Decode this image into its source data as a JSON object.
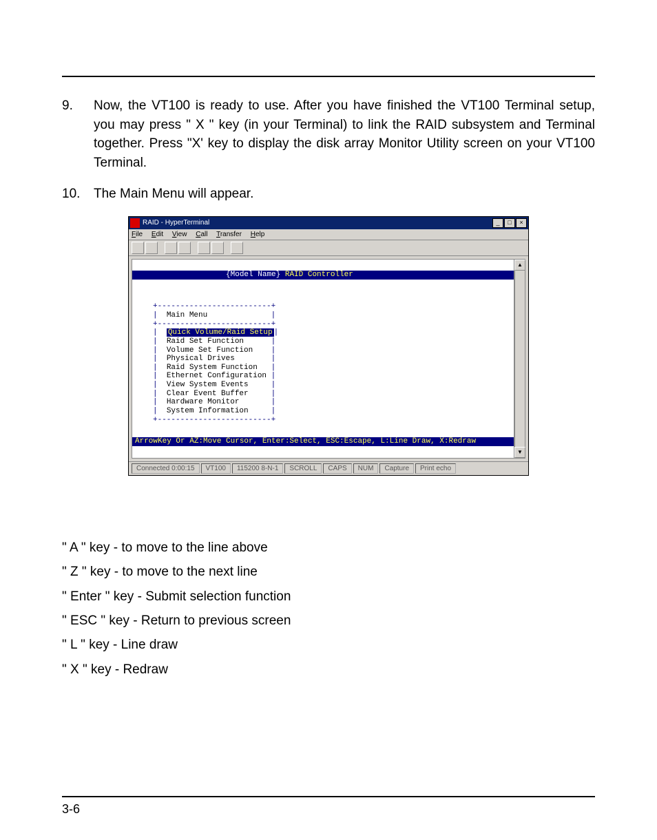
{
  "step9": {
    "num": "9.",
    "text": "Now, the VT100 is ready to use. After you have finished the VT100 Terminal setup, you may press \" X \" key (in your Terminal) to link the RAID subsystem and Terminal together. Press \"X' key to display the disk array Monitor Utility screen on your VT100 Terminal."
  },
  "step10": {
    "num": "10.",
    "text": "The Main Menu will appear."
  },
  "ht": {
    "title": "RAID - HyperTerminal",
    "menubar": {
      "file": "File",
      "edit": "Edit",
      "view": "View",
      "call": "Call",
      "transfer": "Transfer",
      "help": "Help"
    },
    "headbar": {
      "left": "{Model Name}",
      "right": " RAID Controller"
    },
    "menu_title": "Main Menu",
    "menu_items": {
      "i0": "Quick Volume/Raid Setup",
      "i1": "Raid Set Function",
      "i2": "Volume Set Function",
      "i3": "Physical Drives",
      "i4": "Raid System Function",
      "i5": "Ethernet Configuration",
      "i6": "View System Events",
      "i7": "Clear Event Buffer",
      "i8": "Hardware Monitor",
      "i9": "System Information"
    },
    "footbar": "ArrowKey Or AZ:Move Cursor, Enter:Select, ESC:Escape, L:Line Draw, X:Redraw",
    "status": {
      "conn": "Connected 0:00:15",
      "emul": "VT100",
      "baud": "115200 8-N-1",
      "scroll": "SCROLL",
      "caps": "CAPS",
      "num": "NUM",
      "capture": "Capture",
      "echo": "Print echo"
    }
  },
  "keys": {
    "a": "\" A \" key - to move to the line above",
    "z": "\" Z \" key - to move to the next line",
    "enter": "\" Enter \" key - Submit selection function",
    "esc": "\" ESC \" key - Return to previous screen",
    "l": "\" L \" key - Line draw",
    "x": "\" X \" key - Redraw"
  },
  "page_num": "3-6"
}
